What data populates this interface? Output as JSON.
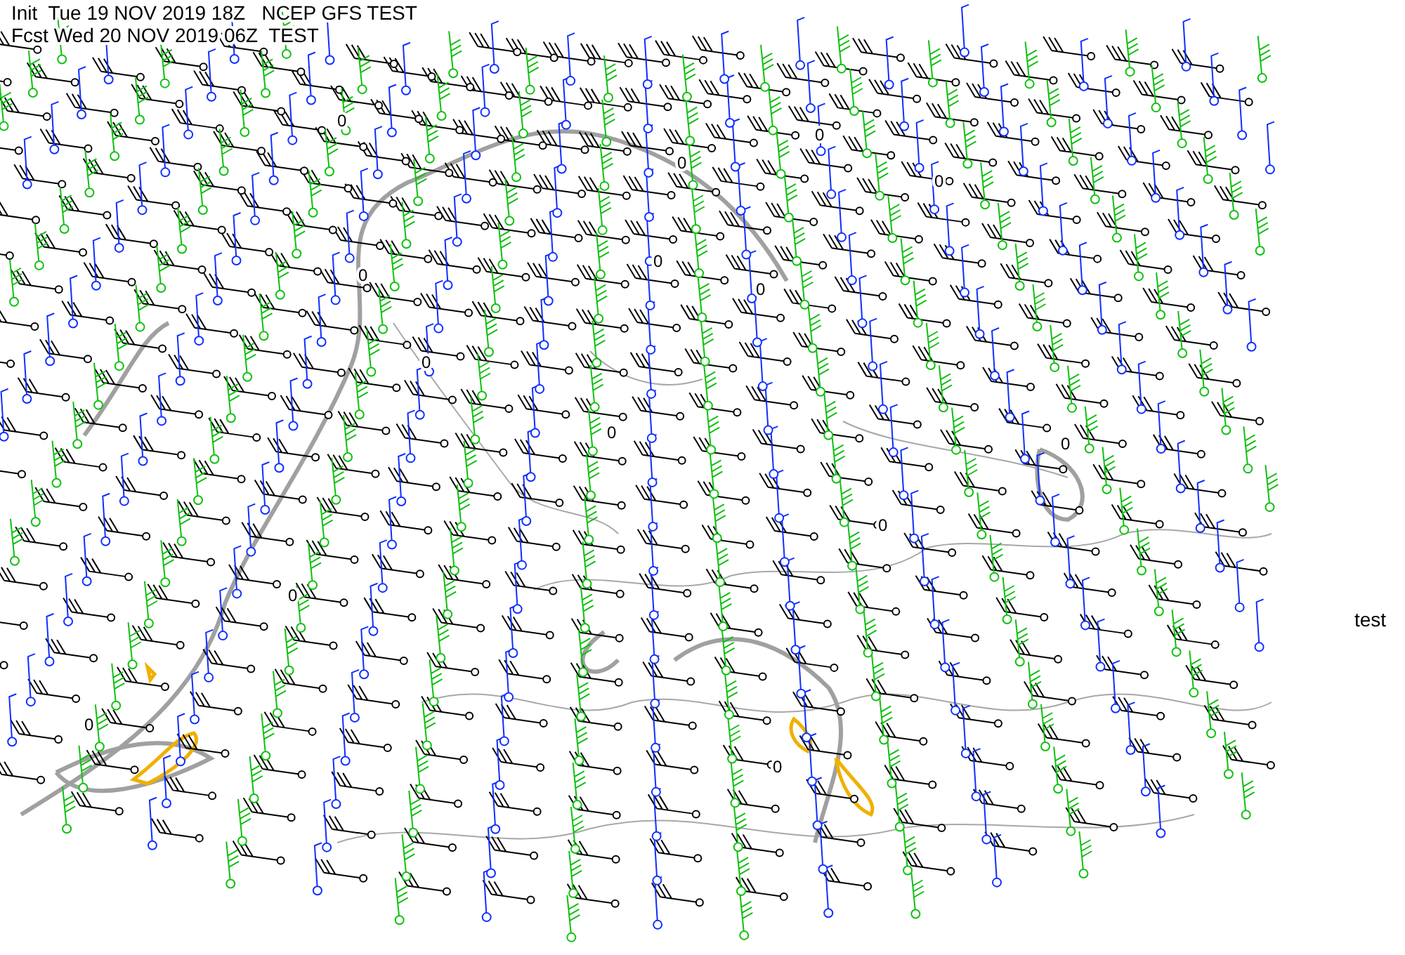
{
  "header": {
    "init_line": "Init  Tue 19 NOV 2019 18Z   NCEP GFS TEST",
    "forecast_line": "Fcst Wed 20 NOV 2019 06Z  TEST"
  },
  "side_label": "test",
  "contour_labels": [
    "0",
    "0",
    "0",
    "0",
    "0",
    "0",
    "0",
    "0",
    "0",
    "0",
    "0",
    "0",
    "0",
    "0"
  ]
}
